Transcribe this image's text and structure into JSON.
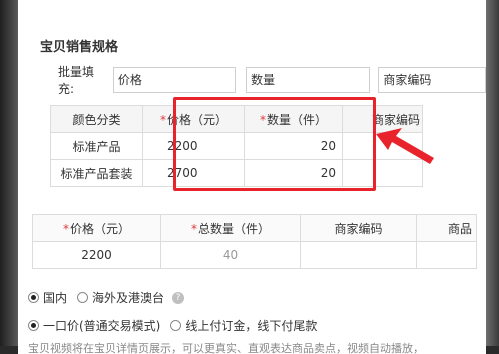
{
  "section_title": "宝贝销售规格",
  "batch": {
    "label": "批量填充:",
    "fields": [
      {
        "value": "价格"
      },
      {
        "value": "数量"
      },
      {
        "value": "商家编码"
      }
    ]
  },
  "sku_table": {
    "headers": {
      "color_category": "颜色分类",
      "price": "价格（元）",
      "quantity": "数量（件）",
      "merchant_code": "商家编码"
    },
    "required_mark": "*",
    "rows": [
      {
        "name": "标准产品",
        "price": "2200",
        "quantity": "20"
      },
      {
        "name": "标准产品套装",
        "price": "2700",
        "quantity": "20"
      }
    ]
  },
  "totals_table": {
    "headers": {
      "price": "价格（元）",
      "total_quantity": "总数量（件）",
      "merchant_code": "商家编码",
      "product_barcode": "商品"
    },
    "values": {
      "price": "2200",
      "total_quantity": "40"
    }
  },
  "region": {
    "options": [
      {
        "label": "国内",
        "checked": true
      },
      {
        "label": "海外及港澳台",
        "checked": false
      }
    ],
    "help_icon": "?"
  },
  "sale_mode": {
    "options": [
      {
        "label": "一口价(普通交易模式)",
        "checked": true
      },
      {
        "label": "线上付订金，线下付尾款",
        "checked": false
      }
    ]
  },
  "footer_note": "宝贝视频将在宝贝详情页展示，可以更真实、直观表达商品卖点，视频自动播放，"
}
